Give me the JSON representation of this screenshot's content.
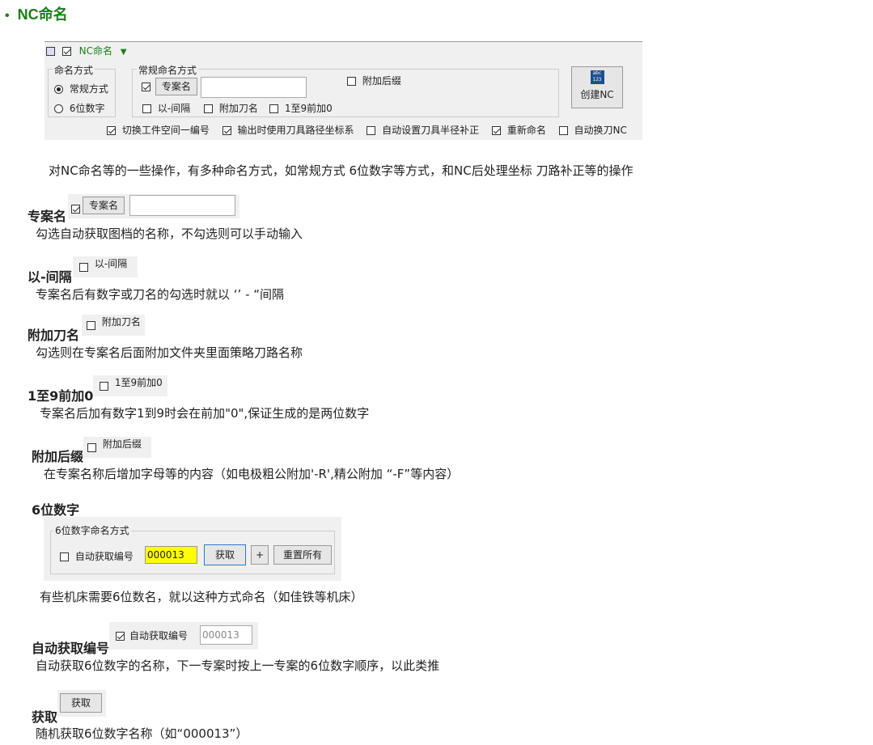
{
  "title": "NC命名",
  "panel": {
    "header_label": "NC命名",
    "naming_mode_group": "命名方式",
    "radio_regular": "常规方式",
    "radio_six": "6位数字",
    "regular_group": "常规命名方式",
    "project_name_btn": "专案名",
    "project_name_value": "",
    "attach_suffix": "附加后缀",
    "dash_sep": "以-间隔",
    "attach_tool": "附加刀名",
    "pad_zero": "1至9前加0",
    "create_nc": "创建NC",
    "create_icon_text": "abc\n123",
    "opt_switch_ws": "切换工件空间一编号",
    "opt_tool_radius": "输出时使用刀具路径坐标系",
    "opt_auto_comp": "自动设置刀具半径补正",
    "opt_rename": "重新命名",
    "opt_tool_change": "自动换刀NC"
  },
  "intro": "对NC命名等的一些操作，有多种命名方式，如常规方式 6位数字等方式，和NC后处理坐标 刀路补正等的操作",
  "sections": [
    {
      "heading": "专案名",
      "desc": "勾选自动获取图档的名称，不勾选则可以手动输入",
      "control": "专案名"
    },
    {
      "heading": "以-间隔",
      "desc": "专案名后有数字或刀名的勾选时就以 ‘’ - “间隔",
      "control": "以-间隔"
    },
    {
      "heading": "附加刀名",
      "desc": "勾选则在专案名后面附加文件夹里面策略刀路名称",
      "control": "附加刀名"
    },
    {
      "heading": "1至9前加0",
      "desc": "专案名后加有数字1到9时会在前加\"0\",保证生成的是两位数字",
      "control": "1至9前加0"
    },
    {
      "heading": "附加后缀",
      "desc": "在专案名称后增加字母等的内容（如电极粗公附加'-R',精公附加 “-F”等内容）",
      "control": "附加后缀"
    },
    {
      "heading": "6位数字",
      "desc": "有些机床需要6位数名，就以这种方式命名（如佳铁等机床）"
    },
    {
      "heading": "自动获取编号",
      "desc": "自动获取6位数字的名称，下一专案时按上一专案的6位数字顺序，以此类推",
      "control": "自动获取编号",
      "value": "000013"
    },
    {
      "heading": "获取",
      "desc": "随机获取6位数字名称（如“000013”）",
      "control": "获取"
    }
  ],
  "six_panel": {
    "group": "6位数字命名方式",
    "auto_label": "自动获取编号",
    "value": "000013",
    "get_btn": "获取",
    "plus_btn": "+",
    "reset_btn": "重置所有"
  },
  "colors": {
    "title_green": "#1a7f1a",
    "highlight_yellow": "#ffff00",
    "panel_bg": "#f0f0f0"
  }
}
